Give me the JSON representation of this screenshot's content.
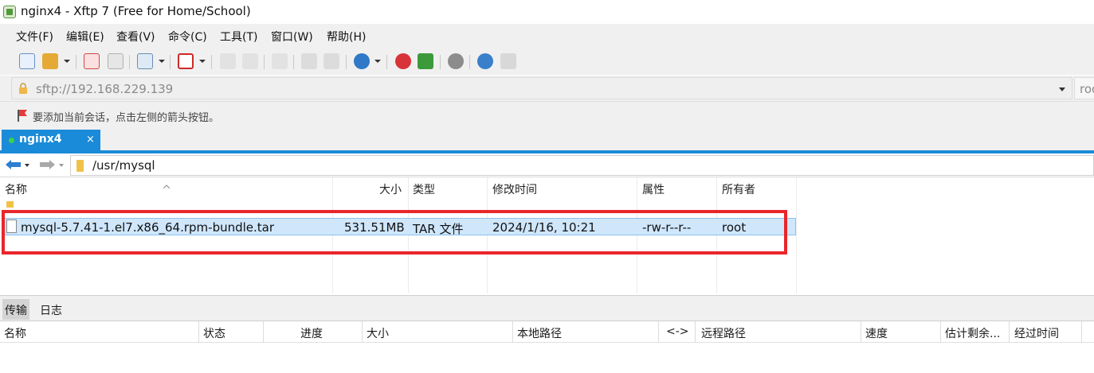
{
  "window": {
    "title": "nginx4 - Xftp 7 (Free for Home/School)"
  },
  "menu": [
    {
      "label": "文件(F)"
    },
    {
      "label": "编辑(E)"
    },
    {
      "label": "查看(V)"
    },
    {
      "label": "命令(C)"
    },
    {
      "label": "工具(T)"
    },
    {
      "label": "窗口(W)"
    },
    {
      "label": "帮助(H)"
    }
  ],
  "toolbar": {
    "icons": [
      "new-session-icon",
      "open-folder-icon",
      "connect-icon",
      "disconnect-icon",
      "new-file-transfer-icon",
      "video-icon",
      "upload-icon",
      "download-icon",
      "sync-icon",
      "copy-icon",
      "paste-icon",
      "globe-icon",
      "xshell-icon",
      "xftp-icon",
      "settings-icon",
      "help-icon",
      "chat-icon"
    ]
  },
  "address": {
    "url": "sftp://192.168.229.139",
    "user": "roo"
  },
  "hint": {
    "text": "要添加当前会话，点击左侧的箭头按钮。"
  },
  "session_tab": {
    "name": "nginx4",
    "close": "×",
    "status_color": "#3bd34a"
  },
  "path": {
    "current": "/usr/mysql"
  },
  "file_columns": {
    "name": "名称",
    "size": "大小",
    "type": "类型",
    "modified": "修改时间",
    "attributes": "属性",
    "owner": "所有者"
  },
  "files": [
    {
      "name": "mysql-5.7.41-1.el7.x86_64.rpm-bundle.tar",
      "size": "531.51MB",
      "type": "TAR 文件",
      "modified": "2024/1/16, 10:21",
      "attributes": "-rw-r--r--",
      "owner": "root"
    }
  ],
  "bottom_tabs": [
    {
      "label": "传输"
    },
    {
      "label": "日志"
    }
  ],
  "transfer_columns": {
    "name": "名称",
    "status": "状态",
    "progress": "进度",
    "size": "大小",
    "local_path": "本地路径",
    "direction": "<->",
    "remote_path": "远程路径",
    "speed": "速度",
    "eta": "估计剩余...",
    "elapsed": "经过时间"
  },
  "colors": {
    "accent": "#1a8bd8",
    "highlight_border": "#e8262b",
    "selection": "#cfe6fb"
  }
}
